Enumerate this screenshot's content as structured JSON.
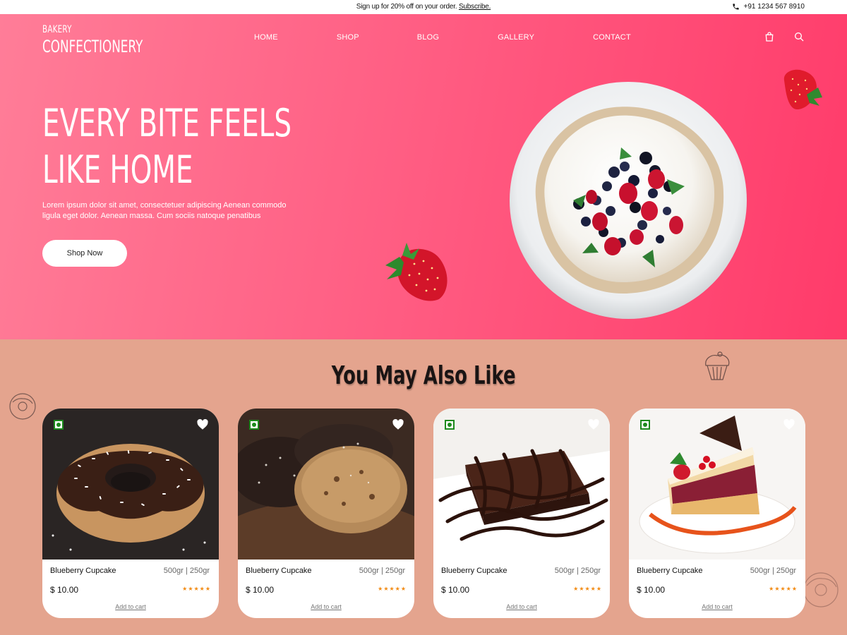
{
  "topbar": {
    "promo_text": "Sign up for 20% off on your order.",
    "promo_link": "Subscribe.",
    "phone": "+91 1234 567 8910"
  },
  "header": {
    "logo_line1": "BAKERY",
    "logo_line2": "CONFECTIONERY",
    "nav": [
      "HOME",
      "SHOP",
      "BLOG",
      "GALLERY",
      "CONTACT"
    ],
    "icons": [
      "shopping-bag-icon",
      "search-icon"
    ]
  },
  "hero": {
    "headline_line1": "EVERY BITE FEELS",
    "headline_line2": "LIKE HOME",
    "description": "Lorem ipsum dolor sit amet, consectetuer adipiscing Aenean commodo ligula eget dolor. Aenean massa. Cum sociis natoque penatibus",
    "cta": "Shop Now",
    "gradient": [
      "#ff7d98",
      "#ff3b6a"
    ]
  },
  "section": {
    "title": "You May Also Like"
  },
  "products": [
    {
      "image": "donut",
      "name": "Blueberry Cupcake",
      "weight": "500gr | 250gr",
      "price": "$ 10.00",
      "stars": "★★★★★",
      "cart": "Add to cart"
    },
    {
      "image": "cookies",
      "name": "Blueberry Cupcake",
      "weight": "500gr | 250gr",
      "price": "$ 10.00",
      "stars": "★★★★★",
      "cart": "Add to cart"
    },
    {
      "image": "brownie",
      "name": "Blueberry Cupcake",
      "weight": "500gr | 250gr",
      "price": "$ 10.00",
      "stars": "★★★★★",
      "cart": "Add to cart"
    },
    {
      "image": "cheesecake",
      "name": "Blueberry Cupcake",
      "weight": "500gr | 250gr",
      "price": "$ 10.00",
      "stars": "★★★★★",
      "cart": "Add to cart"
    }
  ],
  "colors": {
    "section_bg": "#e4a48e",
    "veg_badge": "#1d8a1d",
    "star": "#f28a12"
  }
}
